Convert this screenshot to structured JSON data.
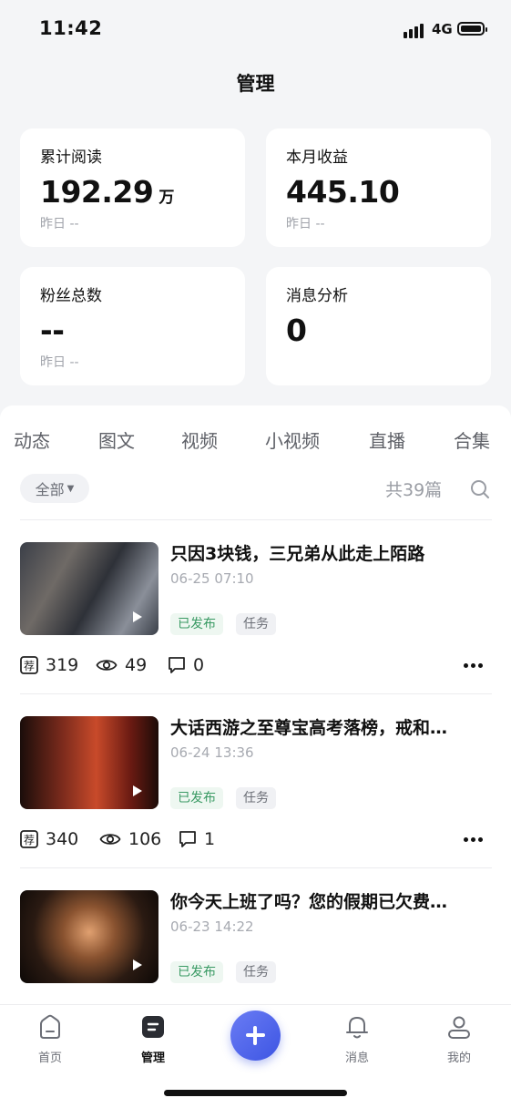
{
  "status_bar": {
    "time": "11:42",
    "network": "4G"
  },
  "header": {
    "title": "管理"
  },
  "stats": [
    {
      "label": "累计阅读",
      "value": "192.29",
      "unit": "万",
      "sub": "昨日 --"
    },
    {
      "label": "本月收益",
      "value": "445.10",
      "unit": "",
      "sub": "昨日 --"
    },
    {
      "label": "粉丝总数",
      "value": "--",
      "unit": "",
      "sub": "昨日 --"
    },
    {
      "label": "消息分析",
      "value": "0",
      "unit": "",
      "sub": ""
    }
  ],
  "tabs": [
    "动态",
    "图文",
    "视频",
    "小视频",
    "直播",
    "合集"
  ],
  "filter": {
    "label": "全部",
    "total": "共39篇"
  },
  "posts": [
    {
      "title": "只因3块钱，三兄弟从此走上陌路",
      "date": "06-25 07:10",
      "tags": [
        "已发布",
        "任务"
      ],
      "recommend": "319",
      "views": "49",
      "comments": "0"
    },
    {
      "title": "大话西游之至尊宝高考落榜，戒和…",
      "date": "06-24 13:36",
      "tags": [
        "已发布",
        "任务"
      ],
      "recommend": "340",
      "views": "106",
      "comments": "1"
    },
    {
      "title": "你今天上班了吗？您的假期已欠费…",
      "date": "06-23 14:22",
      "tags": [
        "已发布",
        "任务"
      ]
    }
  ],
  "icons": {
    "recommend": "荐"
  },
  "bottom_nav": [
    {
      "label": "首页"
    },
    {
      "label": "管理"
    },
    {
      "label": "消息"
    },
    {
      "label": "我的"
    }
  ],
  "colors": {
    "accent": "#3d55e3",
    "tag_green": "#3a9a64",
    "background": "#f4f5f7"
  }
}
